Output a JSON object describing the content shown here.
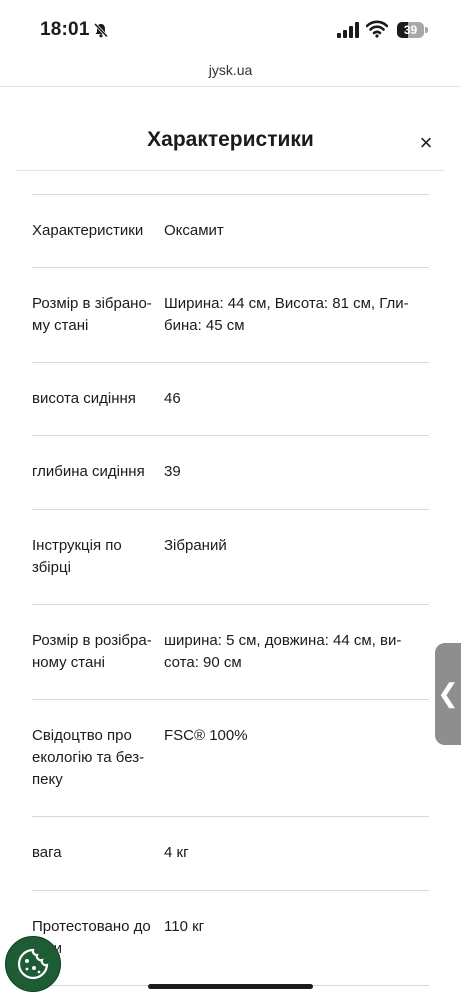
{
  "status_bar": {
    "time": "18:01",
    "battery": "39",
    "battery_level": 0.39
  },
  "browser": {
    "url": "jysk.ua"
  },
  "panel": {
    "title": "Характеристики",
    "close_symbol": "×"
  },
  "specs": [
    {
      "label": "Характеристики",
      "value": "Оксамит"
    },
    {
      "label": "Розмір в зібрано-му стані",
      "value": "Ширина: 44 см, Висота: 81 см, Гли-бина: 45 см"
    },
    {
      "label": "висота сидіння",
      "value": "46"
    },
    {
      "label": "глибина сидіння",
      "value": "39"
    },
    {
      "label": "Інструкція по збірці",
      "value": "Зібраний"
    },
    {
      "label": "Розмір в розібра-ному стані",
      "value": "ширина: 5 см, довжина: 44 см, ви-сота: 90 см"
    },
    {
      "label": "Свідоцтво про екологію та без-пеку",
      "value": "FSC® 100%"
    },
    {
      "label": "вага",
      "value": "4 кг"
    },
    {
      "label": "Протестовано до ваги",
      "value": "110 кг"
    }
  ],
  "side_tab": {
    "symbol": "❮"
  },
  "icons": {
    "bell": "bell-slash-icon",
    "signal": "cellular-signal-icon",
    "wifi": "wifi-icon",
    "cookie": "cookie-icon",
    "side": "chevron-left-icon"
  },
  "colors": {
    "cookie_button": "#1d5c35",
    "divider": "#d8d8d8",
    "side_tab": "#8e8e8e"
  }
}
